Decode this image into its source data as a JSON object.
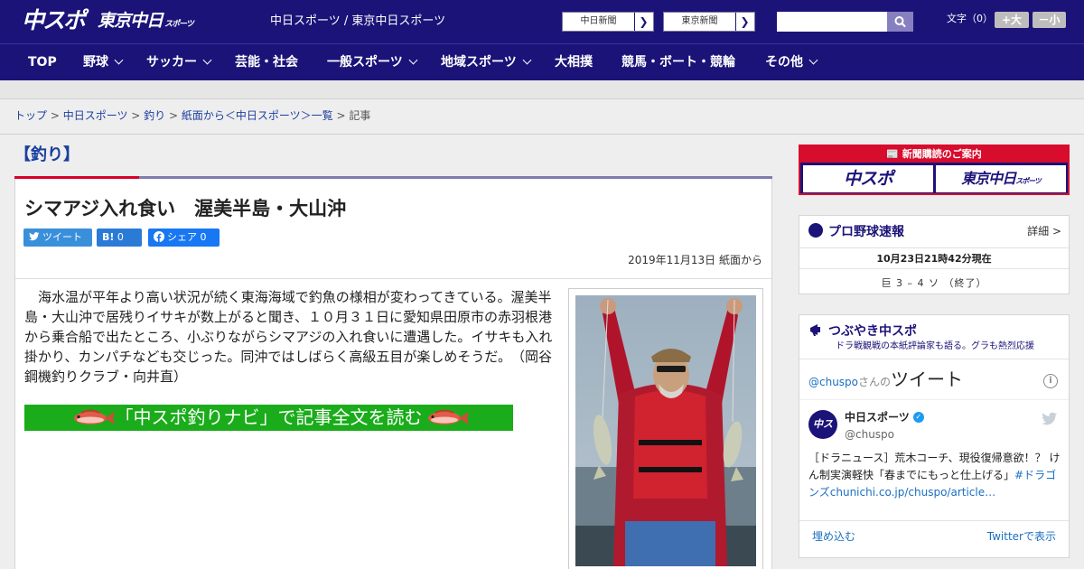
{
  "header": {
    "logo_main": "中スポ",
    "logo_tokyo": "東京中日",
    "logo_tokyo_small": "スポーツ",
    "site_title": "中日スポーツ / 東京中日スポーツ",
    "links": [
      {
        "label": "中日新聞"
      },
      {
        "label": "東京新聞"
      }
    ],
    "search": {
      "placeholder": "",
      "value": ""
    },
    "font_size_label": "文字（0）",
    "font_bigger": "+大",
    "font_smaller": "－小"
  },
  "nav": {
    "items": [
      {
        "label": "TOP"
      },
      {
        "label": "野球"
      },
      {
        "label": "サッカー"
      },
      {
        "label": "芸能・社会"
      },
      {
        "label": "一般スポーツ"
      },
      {
        "label": "地域スポーツ"
      },
      {
        "label": "大相撲"
      },
      {
        "label": "競馬・ボート・競輪"
      },
      {
        "label": "その他"
      }
    ]
  },
  "breadcrumb": {
    "items": [
      "トップ",
      "中日スポーツ",
      "釣り",
      "紙面から＜中日スポーツ＞一覧"
    ],
    "current": "記事",
    "separator": " > "
  },
  "article": {
    "category": "【釣り】",
    "title": "シマアジ入れ食い　渥美半島・大山沖",
    "share": {
      "tweet": "ツイート",
      "hatena_count": "0",
      "facebook": "シェア",
      "facebook_count": "0"
    },
    "date": "2019年11月13日 紙面から",
    "lead": "海水温が平年より高い状況が続く東海海域で釣魚の様相が変わってきている。渥美半島・大山沖で居残りイサキが数上がると聞き、１０月３１日に愛知県田原市の赤羽根港から乗合船で出たところ、小ぶりながらシマアジの入れ食いに遭遇した。イサキも入れ掛かり、カンパチなども交じった。同沖ではしばらく高級五目が楽しめそうだ。　（岡谷鋼機釣りクラブ・向井直）",
    "cta": "「中スポ釣りナビ」で記事全文を読む"
  },
  "sidebar": {
    "ad": {
      "title": "新聞購読のご案内",
      "logo_a": "中スポ",
      "logo_b": "東京中日",
      "logo_b_small": "スポーツ"
    },
    "baseball": {
      "title": "プロ野球速報",
      "detail": "詳細 >",
      "updated": "10月23日21時42分現在",
      "score": "巨 3 – 4 ソ （終了）"
    },
    "twitter": {
      "title": "つぶやき中スポ",
      "subtitle": "ドラ戦観戦の本紙評論家も語る。グラも熱烈応援",
      "handle_prefix": "@chuspo",
      "handle_suffix": "さんの",
      "header_big": "ツイート",
      "account_name": "中日スポーツ",
      "account_handle": "@chuspo",
      "avatar_text": "中ス",
      "tweet_text": "［ドラニュース］荒木コーチ、現役復帰意欲！？ けん制実演軽快「春までにもっと仕上げる」",
      "tweet_tag": "#ドラゴンズchunichi.co.jp/chuspo/article…",
      "embed": "埋め込む",
      "view_on_twitter": "Twitterで表示"
    }
  },
  "colors": {
    "brand_navy": "#1b1378",
    "accent_red": "#d6002a",
    "link_blue": "#1b3fa0",
    "cta_green": "#1aac1a"
  }
}
